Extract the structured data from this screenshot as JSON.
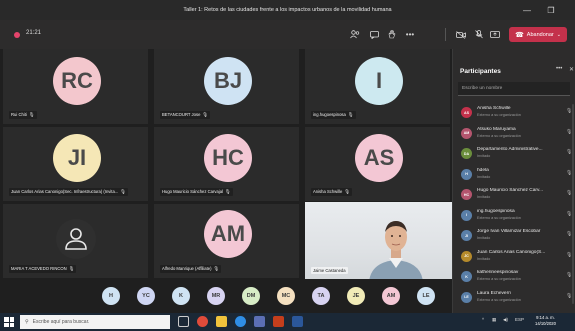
{
  "window": {
    "title": "Taller 1: Retos de las ciudades frente a los impactos urbanos de la movilidad humana",
    "minimize": "—",
    "restore": "❐"
  },
  "toolbar": {
    "timer": "21:21",
    "leave_label": "Abandonar",
    "leave_color": "#c4314b"
  },
  "tiles": [
    {
      "initials": "RC",
      "name": "Rui Chiti",
      "color": "#f3c7cd"
    },
    {
      "initials": "BJ",
      "name": "BETANCOURT Jose",
      "color": "#cfe3f3"
    },
    {
      "initials": "I",
      "name": "ing.hugoespinosa",
      "color": "#cde9f0"
    },
    {
      "initials": "JI",
      "name": "Juan Carlos Arias Canonigo(Sec. Infraestructura) (Invita...",
      "color": "#f5e7b6"
    },
    {
      "initials": "HC",
      "name": "Hugo Mauricio Sánchez Carvajal",
      "color": "#f3c7d4"
    },
    {
      "initials": "AS",
      "name": "Anisha Schwille",
      "color": "#f3c7d4"
    },
    {
      "initials": "",
      "name": "MARIA T ACEVEDO RINCON",
      "color": "#2f2f2f"
    },
    {
      "initials": "AM",
      "name": "Alfredo Manrique (Affiliate)",
      "color": "#f3c7d4"
    },
    {
      "initials": "",
      "name": "Jaime Castaneda",
      "color": "#e4e7ea"
    }
  ],
  "strip": [
    {
      "initials": "H",
      "color": "#cfe3f3"
    },
    {
      "initials": "YC",
      "color": "#cfd6f3"
    },
    {
      "initials": "K",
      "color": "#cfe3f3"
    },
    {
      "initials": "MR",
      "color": "#d7d3f1"
    },
    {
      "initials": "DM",
      "color": "#d7ecc6"
    },
    {
      "initials": "MC",
      "color": "#f5e0c0"
    },
    {
      "initials": "TA",
      "color": "#d7d3f1"
    },
    {
      "initials": "JE",
      "color": "#f1ebb7"
    },
    {
      "initials": "AM",
      "color": "#f3c7d4"
    },
    {
      "initials": "LE",
      "color": "#cfe3f3"
    }
  ],
  "panel": {
    "title": "Participantes",
    "more": "•••",
    "close": "✕",
    "invite_placeholder": "Escribe un nombre",
    "participants": [
      {
        "initials": "AS",
        "name": "Anisha Schwille",
        "sub": "Externo a su organización",
        "color": "#c4314b"
      },
      {
        "initials": "AM",
        "name": "Atsuko Maruyama",
        "sub": "Externo a su organización",
        "color": "#b4556e"
      },
      {
        "initials": "DA",
        "name": "Departamento Administrative...",
        "sub": "Invitado",
        "color": "#6b8e3c"
      },
      {
        "initials": "H",
        "name": "hdela",
        "sub": "Invitado",
        "color": "#5a7fa8"
      },
      {
        "initials": "HC",
        "name": "Hugo Mauricio Sánchez Carv...",
        "sub": "Invitado",
        "color": "#b4556e"
      },
      {
        "initials": "I",
        "name": "ing.hugoespinosa",
        "sub": "Externo a su organización",
        "color": "#5a7fa8"
      },
      {
        "initials": "JI",
        "name": "Jorge Ivan Villamizar Escobar",
        "sub": "Invitado",
        "color": "#5a7fa8"
      },
      {
        "initials": "JC",
        "name": "Juan Carlos Arias Canonigo(S...",
        "sub": "Invitado",
        "color": "#b58a2b"
      },
      {
        "initials": "K",
        "name": "katherineespinosav",
        "sub": "Externo a su organización",
        "color": "#5a7fa8"
      },
      {
        "initials": "LE",
        "name": "Laura Echeverri",
        "sub": "Externo a su organización",
        "color": "#5a7fa8"
      }
    ]
  },
  "taskbar": {
    "search_placeholder": "Escribe aquí para buscar.",
    "tray_lang": "ESP",
    "time": "9:14 a. m.",
    "date": "14/10/2020"
  }
}
